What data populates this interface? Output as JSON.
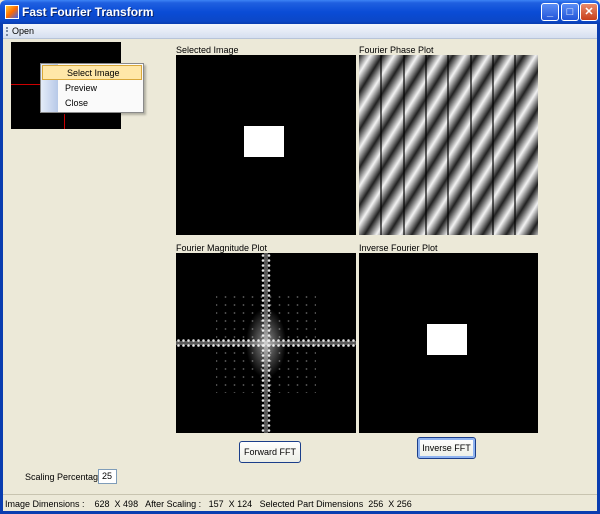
{
  "window": {
    "title": "Fast Fourier Transform",
    "minimize_glyph": "_",
    "maximize_glyph": "□",
    "close_glyph": "✕"
  },
  "menu": {
    "open_label": "Open"
  },
  "context_menu": {
    "items": [
      {
        "label": "Select Image",
        "highlighted": true
      },
      {
        "label": "Preview",
        "highlighted": false
      },
      {
        "label": "Close",
        "highlighted": false
      }
    ]
  },
  "panels": {
    "selected_image": "Selected Image",
    "fourier_phase": "Fourier Phase Plot",
    "fourier_magnitude": "Fourier Magnitude Plot",
    "inverse_fourier": "Inverse Fourier  Plot"
  },
  "buttons": {
    "forward_fft": "Forward FFT",
    "inverse_fft": "Inverse FFT"
  },
  "scaling": {
    "label": "Scaling Percentage",
    "value": "25"
  },
  "status": {
    "text": "Image Dimensions :    628  X 498   After Scaling :   157  X 124   Selected Part Dimensions  256  X 256"
  },
  "colors": {
    "titlebar": "#0a4cd6",
    "accent_red": "#cc0000",
    "menu_highlight": "#ffe7a8"
  }
}
